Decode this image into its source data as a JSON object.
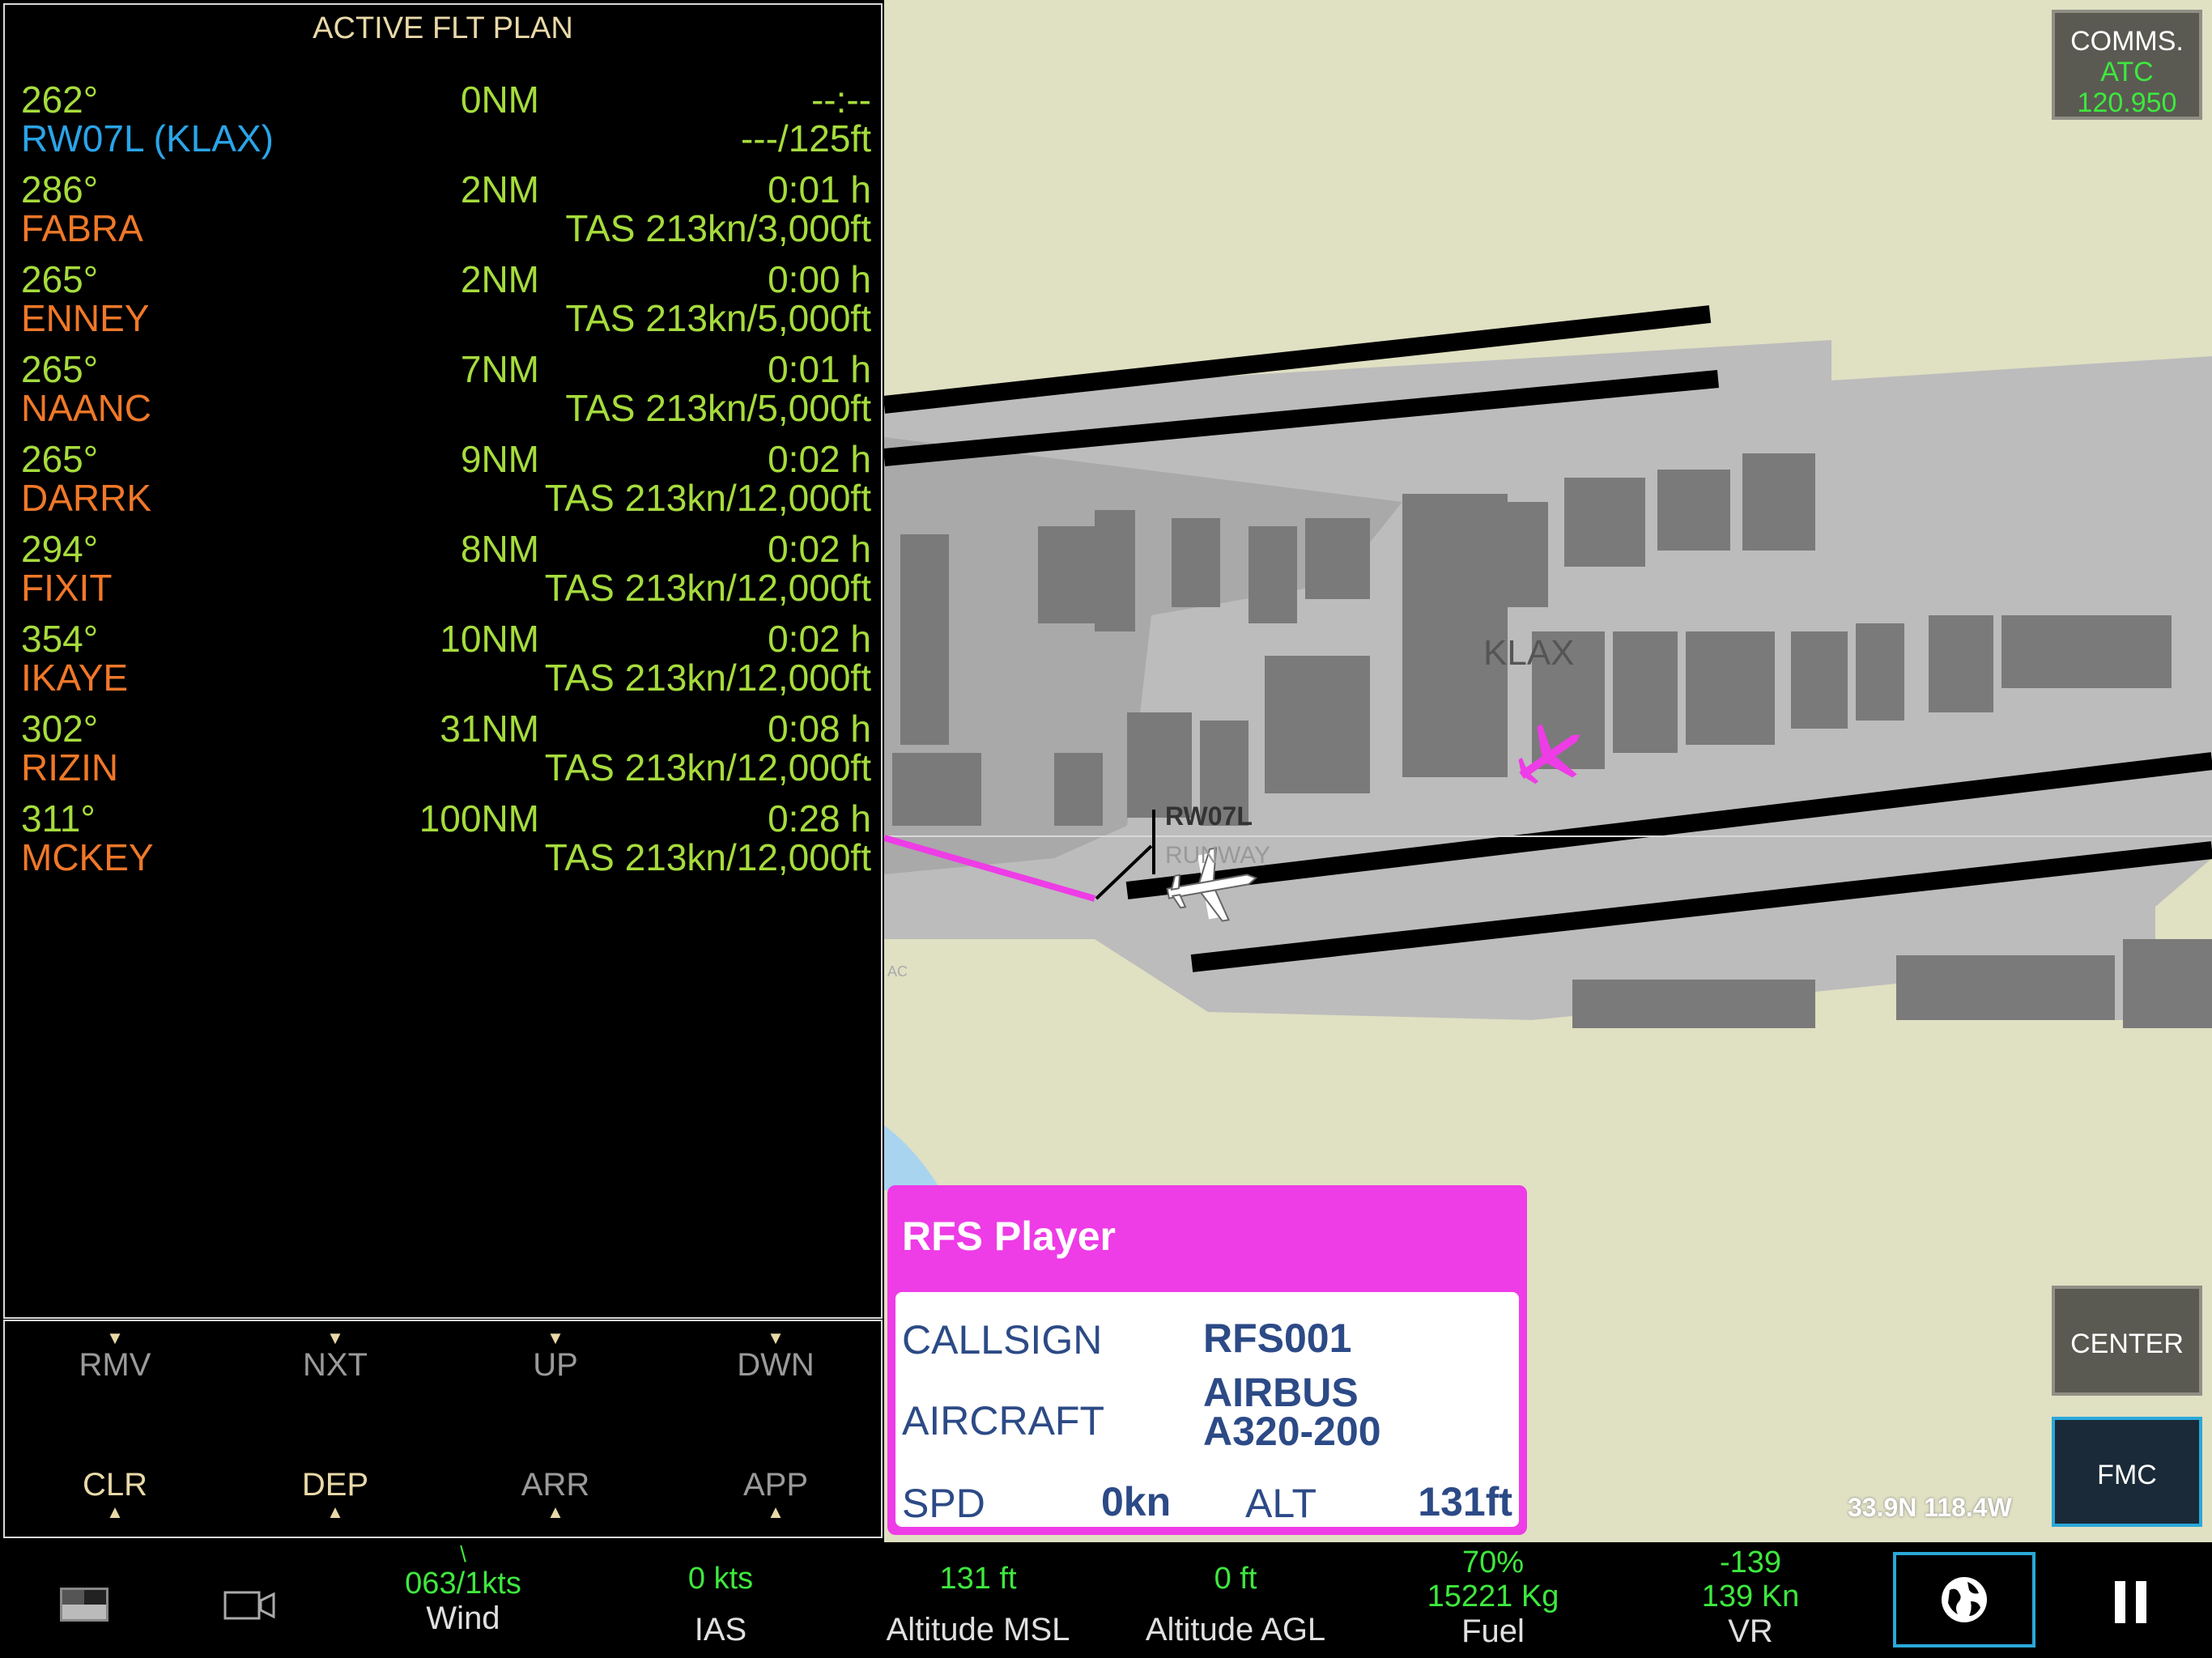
{
  "flight_plan": {
    "title": "ACTIVE FLT PLAN",
    "waypoints": [
      {
        "heading": "262°",
        "distance": "0NM",
        "time": "--:--",
        "name": "RW07L (KLAX)",
        "info": "---/125ft",
        "is_runway": true
      },
      {
        "heading": "286°",
        "distance": "2NM",
        "time": "0:01 h",
        "name": "FABRA",
        "info": "TAS 213kn/3,000ft"
      },
      {
        "heading": "265°",
        "distance": "2NM",
        "time": "0:00 h",
        "name": "ENNEY",
        "info": "TAS 213kn/5,000ft"
      },
      {
        "heading": "265°",
        "distance": "7NM",
        "time": "0:01 h",
        "name": "NAANC",
        "info": "TAS 213kn/5,000ft"
      },
      {
        "heading": "265°",
        "distance": "9NM",
        "time": "0:02 h",
        "name": "DARRK",
        "info": "TAS 213kn/12,000ft"
      },
      {
        "heading": "294°",
        "distance": "8NM",
        "time": "0:02 h",
        "name": "FIXIT",
        "info": "TAS 213kn/12,000ft"
      },
      {
        "heading": "354°",
        "distance": "10NM",
        "time": "0:02 h",
        "name": "IKAYE",
        "info": "TAS 213kn/12,000ft"
      },
      {
        "heading": "302°",
        "distance": "31NM",
        "time": "0:08 h",
        "name": "RIZIN",
        "info": "TAS 213kn/12,000ft"
      },
      {
        "heading": "311°",
        "distance": "100NM",
        "time": "0:28 h",
        "name": "MCKEY",
        "info": "TAS 213kn/12,000ft"
      }
    ],
    "buttons_top": [
      "RMV",
      "NXT",
      "UP",
      "DWN"
    ],
    "buttons_bottom": [
      "CLR",
      "DEP",
      "ARR",
      "APP"
    ]
  },
  "map": {
    "airport_label": "KLAX",
    "runway_id_label": "RW07L",
    "runway_label": "RUNWAY",
    "ac_label": "AC",
    "coords": "33.9N 118.4W",
    "route_color": "#ee3ce6",
    "comms": {
      "title": "COMMS.",
      "atc": "ATC",
      "freq": "120.950"
    },
    "center_label": "CENTER",
    "fmc_label": "FMC"
  },
  "player_card": {
    "title": "RFS Player",
    "callsign_label": "CALLSIGN",
    "callsign": "RFS001",
    "aircraft_label": "AIRCRAFT",
    "aircraft_line1": "AIRBUS",
    "aircraft_line2": "A320-200",
    "spd_label": "SPD",
    "spd": "0kn",
    "alt_label": "ALT",
    "alt": "131ft"
  },
  "status_bar": {
    "wind": {
      "value": "063/1kts",
      "label": "Wind"
    },
    "ias": {
      "value": "0 kts",
      "label": "IAS"
    },
    "alt_msl": {
      "value": "131 ft",
      "label": "Altitude MSL"
    },
    "alt_agl": {
      "value": "0 ft",
      "label": "Altitude AGL"
    },
    "fuel": {
      "pct": "70%",
      "value": "15221 Kg",
      "label": "Fuel"
    },
    "vr": {
      "value1": "-139",
      "value2": "139 Kn",
      "label": "VR"
    }
  }
}
